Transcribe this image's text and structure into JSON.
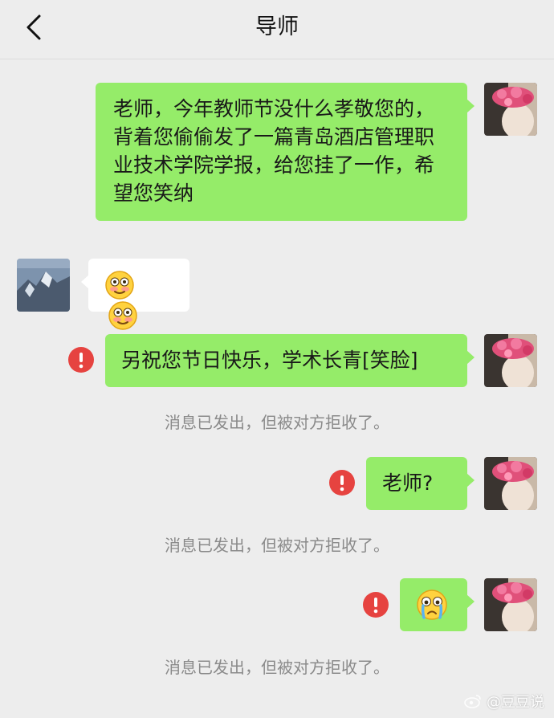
{
  "header": {
    "title": "导师"
  },
  "messages": [
    {
      "text": "老师，今年教师节没什么孝敬您的，背着您偷偷发了一篇青岛酒店管理职业技术学院学报，给您挂了一作，希望您笑纳"
    },
    {
      "emoji_name": "blushing-smile-emoji"
    },
    {
      "text": "另祝您节日快乐，学术长青[笑脸]"
    },
    {
      "text": "老师?"
    },
    {
      "emoji_name": "crying-face-emoji"
    }
  ],
  "system_notice": "消息已发出，但被对方拒收了。",
  "watermark": "@豆豆说",
  "colors": {
    "sent_bubble": "#95ec69",
    "received_bubble": "#ffffff",
    "error": "#e64340",
    "background": "#ededed"
  }
}
